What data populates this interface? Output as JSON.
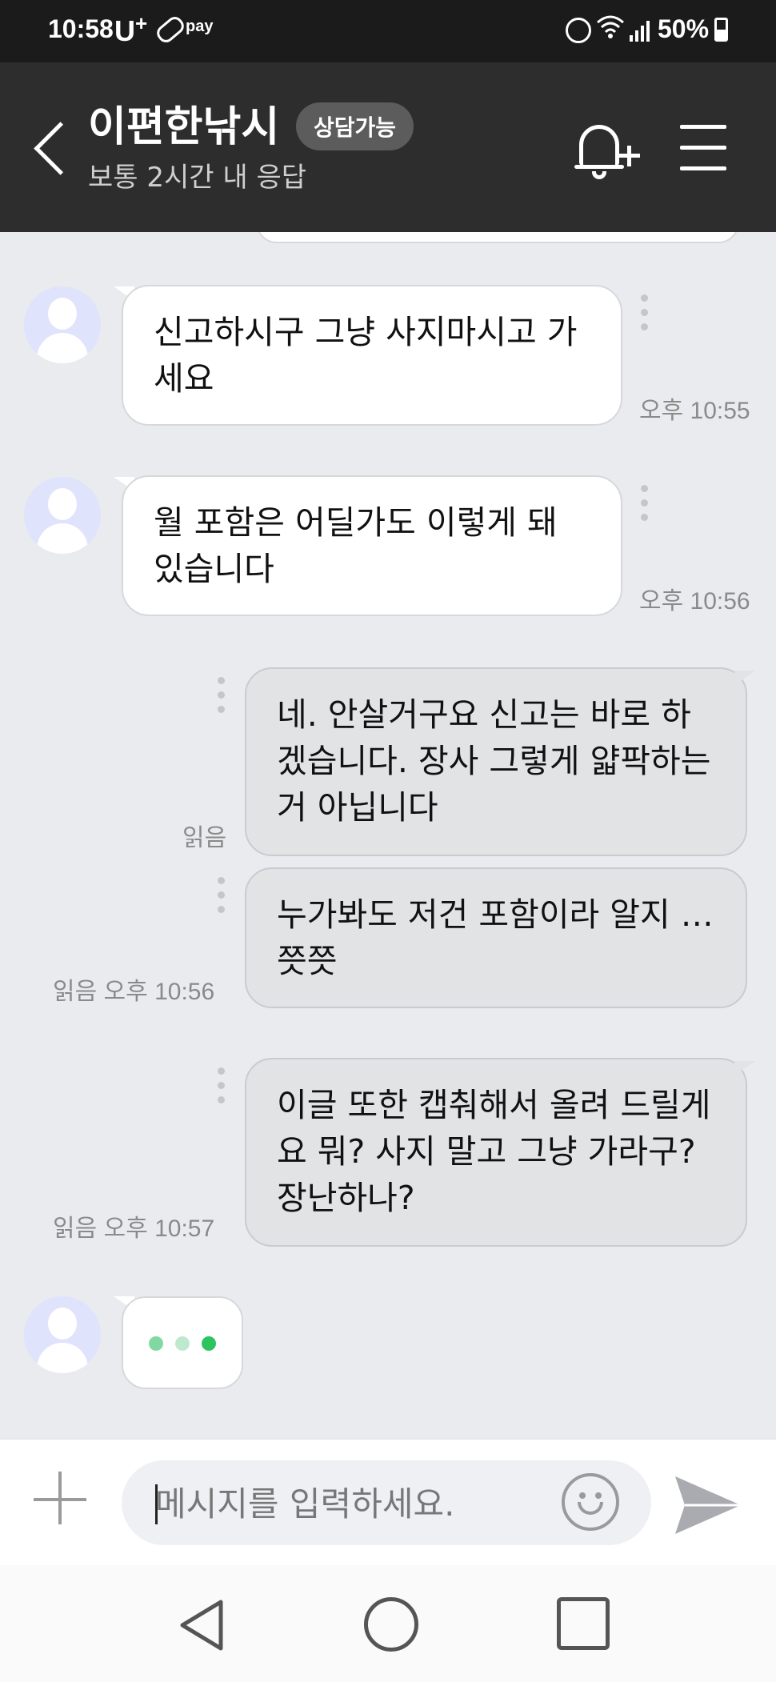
{
  "status_bar": {
    "time": "10:58",
    "carrier": "U",
    "carrier_sup": "+",
    "pay_label": "pay",
    "battery": "50%"
  },
  "header": {
    "title": "이편한낚시",
    "badge": "상담가능",
    "subtitle": "보통 2시간 내 응답"
  },
  "messages": [
    {
      "side": "in",
      "text": "신고하시구 그냥 사지마시고 가세요",
      "time": "오후 10:55"
    },
    {
      "side": "in",
      "text": "월 포함은 어딜가도 이렇게 돼 있습니다",
      "time": "오후 10:56"
    },
    {
      "side": "out",
      "text": "네. 안살거구요 신고는 바로 하겠습니다. 장사 그렇게 얇팍하는거 아닙니다",
      "status": "읽음"
    },
    {
      "side": "out",
      "text": "누가봐도 저건 포함이라 알지 …쯧쯧",
      "status": "읽음 오후 10:56"
    },
    {
      "side": "out",
      "text": "이글 또한 캡춰해서 올려 드릴게요 뭐? 사지 말고 그냥 가라구? 장난하나?",
      "status": "읽음 오후 10:57"
    }
  ],
  "typing_colors": [
    "#7fd9a0",
    "#bfe9cf",
    "#2bc45e"
  ],
  "input": {
    "placeholder": "메시지를 입력하세요."
  },
  "icons": {
    "back": "chevron-left-icon",
    "bell": "bell-plus-icon",
    "menu": "hamburger-icon",
    "attach": "plus-icon",
    "emoji": "smiley-icon",
    "send": "send-icon"
  }
}
